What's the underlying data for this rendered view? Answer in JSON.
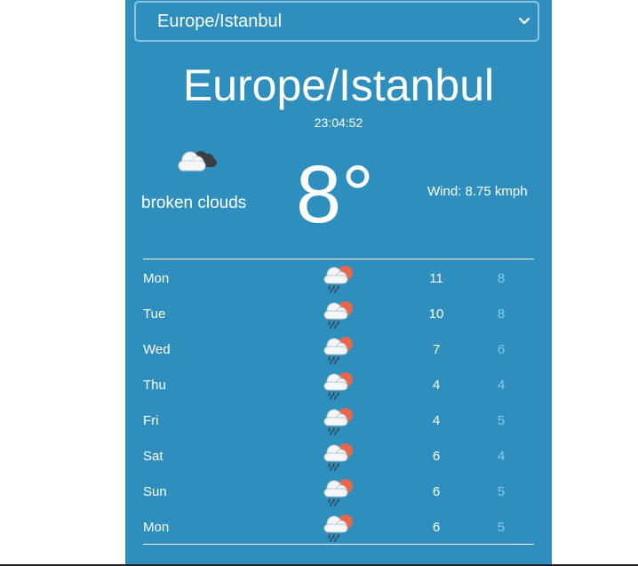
{
  "city_select": {
    "value": "Europe/Istanbul"
  },
  "current": {
    "city": "Europe/Istanbul",
    "time": "23:04:52",
    "icon": "broken-clouds-icon",
    "description": "broken clouds",
    "temperature": "8°",
    "wind": "Wind: 8.75 kmph"
  },
  "forecast": [
    {
      "day": "Mon",
      "icon": "rain-sun-icon",
      "high": "11",
      "low": "8"
    },
    {
      "day": "Tue",
      "icon": "rain-sun-icon",
      "high": "10",
      "low": "8"
    },
    {
      "day": "Wed",
      "icon": "rain-sun-icon",
      "high": "7",
      "low": "6"
    },
    {
      "day": "Thu",
      "icon": "rain-sun-icon",
      "high": "4",
      "low": "4"
    },
    {
      "day": "Fri",
      "icon": "rain-sun-icon",
      "high": "4",
      "low": "5"
    },
    {
      "day": "Sat",
      "icon": "rain-sun-icon",
      "high": "6",
      "low": "4"
    },
    {
      "day": "Sun",
      "icon": "rain-sun-icon",
      "high": "6",
      "low": "5"
    },
    {
      "day": "Mon",
      "icon": "rain-sun-icon",
      "high": "6",
      "low": "5"
    }
  ],
  "colors": {
    "panel": "#2e8fbe",
    "low_temp": "#8ec6e4",
    "sun": "#e8694a"
  }
}
